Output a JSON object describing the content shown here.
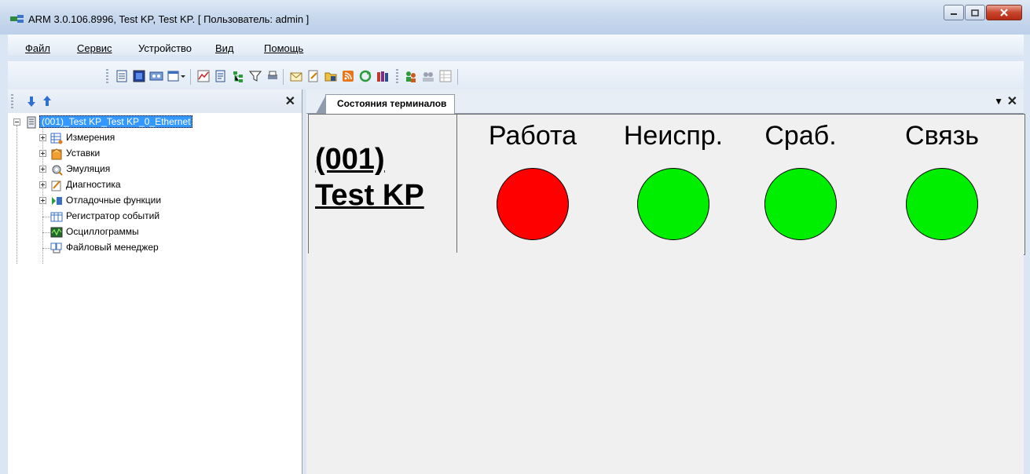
{
  "window": {
    "title": "ARM 3.0.106.8996, Test KP, Test KP. [ Пользователь: admin ]"
  },
  "menu": [
    {
      "label": "Файл"
    },
    {
      "label": "Сервис"
    },
    {
      "label": "Устройство"
    },
    {
      "label": "Вид"
    },
    {
      "label": "Помощь"
    }
  ],
  "tree": {
    "root": "(001)_Test KP_Test KP_0_Ethernet",
    "items": [
      {
        "label": "Измерения"
      },
      {
        "label": "Уставки"
      },
      {
        "label": "Эмуляция"
      },
      {
        "label": "Диагностика"
      },
      {
        "label": "Отладочные функции"
      },
      {
        "label": "Регистратор событий"
      },
      {
        "label": "Осциллограммы"
      },
      {
        "label": "Файловый менеджер"
      }
    ]
  },
  "tab": {
    "label": "Состояния терминалов"
  },
  "terminal": {
    "name_line1": "(001)",
    "name_line2": "Test KP",
    "indicators": [
      {
        "label": "Работа",
        "color": "#ff0000"
      },
      {
        "label": "Неиспр.",
        "color": "#00ee00"
      },
      {
        "label": "Сраб.",
        "color": "#00ee00"
      },
      {
        "label": "Связь",
        "color": "#00ee00"
      }
    ]
  },
  "colors": {
    "selection": "#3399ff",
    "led_red": "#ff0000",
    "led_green": "#00ee00"
  }
}
